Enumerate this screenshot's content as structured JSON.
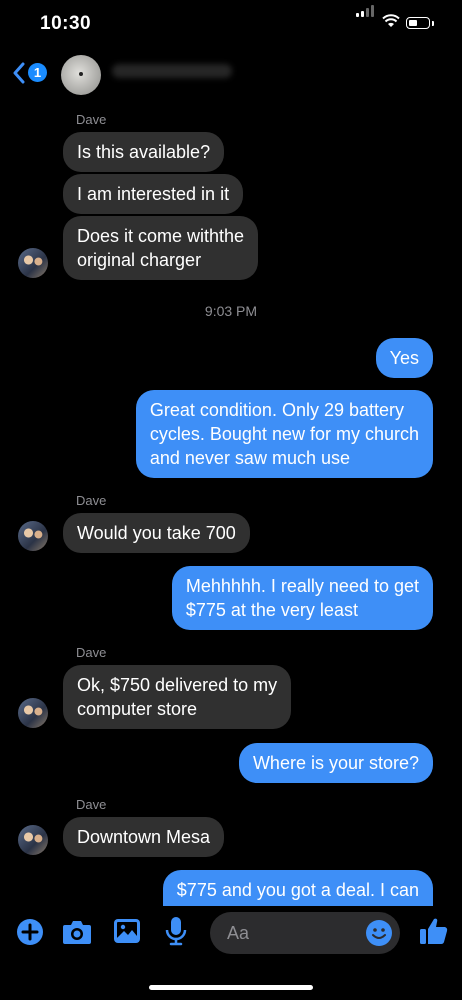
{
  "status_bar": {
    "time": "10:30"
  },
  "header": {
    "unread_count": "1"
  },
  "accent_color": "#3e8ff7",
  "messages": [
    {
      "sender": "Dave"
    },
    {
      "text": "Is this available?"
    },
    {
      "text": "I am interested in it"
    },
    {
      "text": "Does it come withthe\noriginal charger"
    },
    {
      "timestamp": "9:03 PM"
    },
    {
      "text": "Yes"
    },
    {
      "text": "Great condition. Only 29 battery\ncycles. Bought new for my church\nand never saw much use"
    },
    {
      "sender": "Dave"
    },
    {
      "text": "Would you take 700"
    },
    {
      "text": "Mehhhhh. I really need to get\n$775 at the very least"
    },
    {
      "sender": "Dave"
    },
    {
      "text": "Ok, $750 delivered to my\ncomputer store"
    },
    {
      "text": "Where is your store?"
    },
    {
      "sender": "Dave"
    },
    {
      "text": "Downtown Mesa"
    },
    {
      "text": "$775 and you got a deal. I can"
    }
  ],
  "composer": {
    "placeholder": "Aa"
  },
  "icons": [
    "plus-icon",
    "camera-icon",
    "gallery-icon",
    "microphone-icon",
    "emoji-icon",
    "thumbs-up-icon"
  ]
}
